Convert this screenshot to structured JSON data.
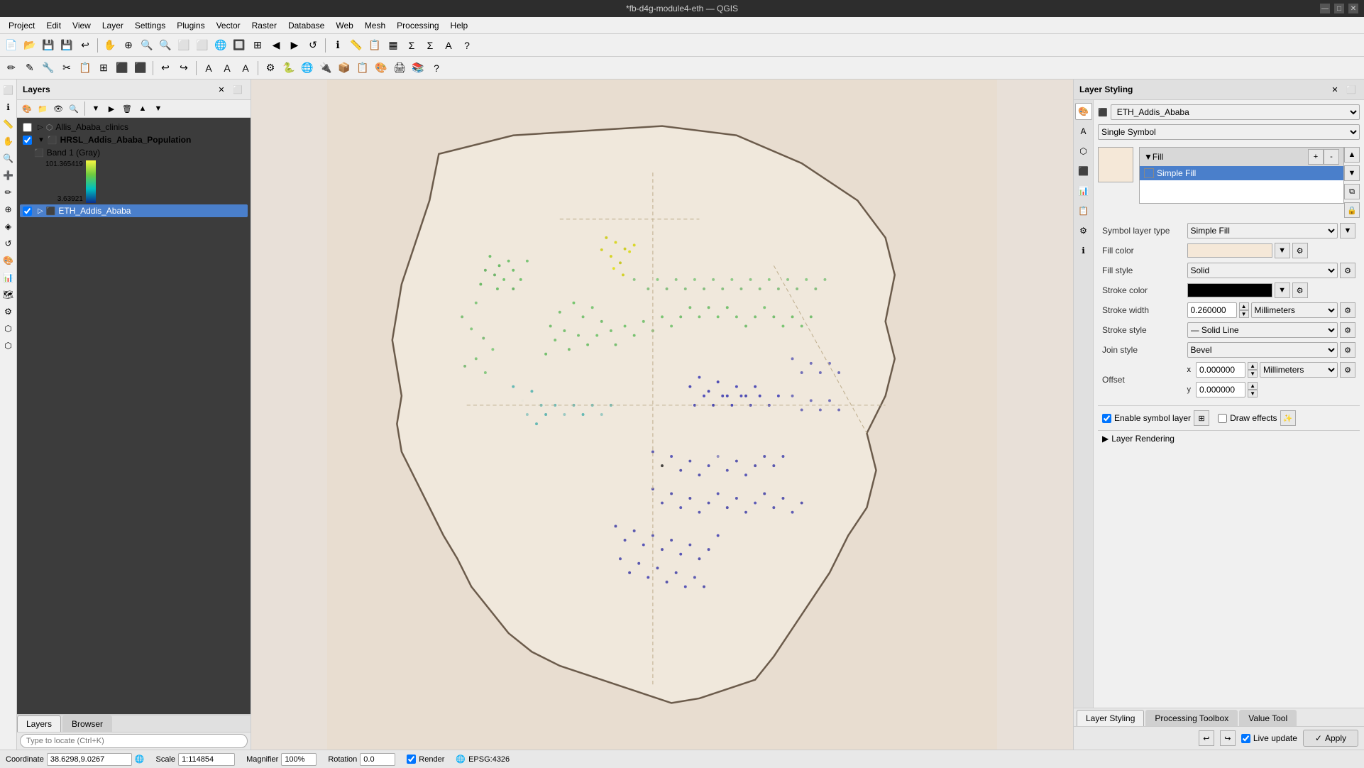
{
  "titlebar": {
    "title": "*fb-d4g-module4-eth — QGIS",
    "min_btn": "—",
    "max_btn": "□",
    "close_btn": "✕"
  },
  "menubar": {
    "items": [
      "Project",
      "Edit",
      "View",
      "Layer",
      "Settings",
      "Plugins",
      "Vector",
      "Raster",
      "Database",
      "Web",
      "Mesh",
      "Processing",
      "Help"
    ]
  },
  "layers_panel": {
    "title": "Layers",
    "layers": [
      {
        "id": "allis",
        "name": "Allis_Ababa_clinics",
        "checked": false,
        "indent": 0,
        "icon": "▷"
      },
      {
        "id": "hrsl",
        "name": "HRSL_Addis_Ababa_Population",
        "checked": true,
        "indent": 0,
        "icon": "✓",
        "bold": true
      },
      {
        "id": "band",
        "name": "Band 1 (Gray)",
        "checked": false,
        "indent": 1,
        "icon": ""
      },
      {
        "id": "val_high",
        "name": "101.365419",
        "indent": 2
      },
      {
        "id": "val_low",
        "name": "3.63921",
        "indent": 2
      },
      {
        "id": "eth",
        "name": "ETH_Addis_Ababa",
        "checked": true,
        "indent": 0,
        "selected": true
      }
    ]
  },
  "layer_styling": {
    "title": "Layer Styling",
    "layer_selector": "ETH_Addis_Ababa",
    "symbol_type_label": "Single Symbol",
    "symbol_tree": {
      "header_label": "Fill",
      "items": [
        {
          "label": "Simple Fill",
          "selected": true
        }
      ]
    },
    "symbol_layer_type_label": "Symbol layer type",
    "symbol_layer_type_value": "Simple Fill",
    "fill_color_label": "Fill color",
    "fill_color_value": "",
    "fill_style_label": "Fill style",
    "fill_style_value": "Solid",
    "stroke_color_label": "Stroke color",
    "stroke_color_value": "#000000",
    "stroke_width_label": "Stroke width",
    "stroke_width_value": "0.260000",
    "stroke_width_unit": "Millimeters",
    "stroke_style_label": "Stroke style",
    "stroke_style_value": "Solid Line",
    "join_style_label": "Join style",
    "join_style_value": "Bevel",
    "offset_label": "Offset",
    "offset_x_value": "0.000000",
    "offset_y_value": "0.000000",
    "offset_unit": "Millimeters",
    "enable_symbol_layer_label": "Enable symbol layer",
    "draw_effects_label": "Draw effects",
    "layer_rendering_label": "Layer Rendering",
    "live_update_label": "Live update",
    "apply_label": "Apply"
  },
  "bottom_tabs": {
    "tabs": [
      {
        "id": "layer-styling",
        "label": "Layer Styling",
        "active": true
      },
      {
        "id": "processing-toolbox",
        "label": "Processing Toolbox",
        "active": false
      },
      {
        "id": "value-tool",
        "label": "Value Tool",
        "active": false
      }
    ]
  },
  "statusbar": {
    "coordinate_label": "Coordinate",
    "coordinate_value": "38.6298,9.0267",
    "scale_label": "Scale",
    "scale_value": "1:114854",
    "magnifier_label": "Magnifier",
    "magnifier_value": "100%",
    "rotation_label": "Rotation",
    "rotation_value": "0.0",
    "render_label": "Render",
    "epsg_label": "EPSG:4326"
  },
  "locate_bar": {
    "placeholder": "Type to locate (Ctrl+K)"
  }
}
